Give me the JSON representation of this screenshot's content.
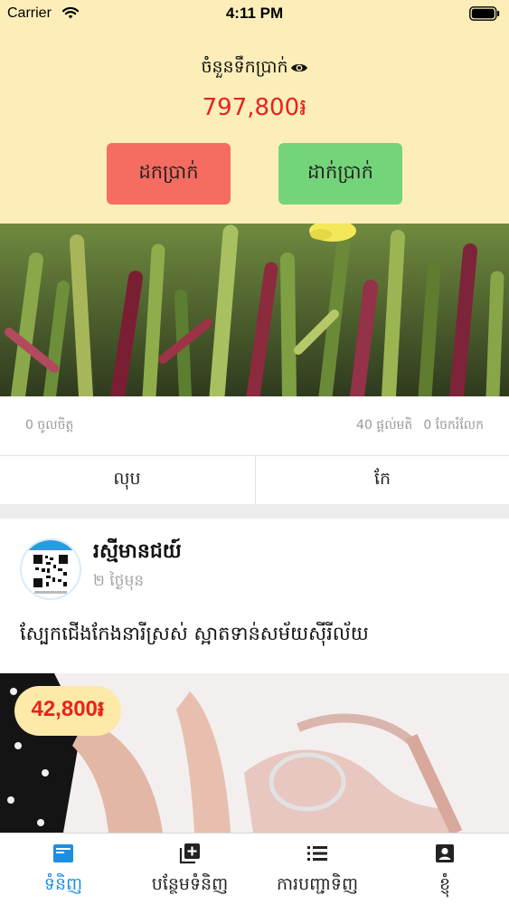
{
  "status_bar": {
    "carrier": "Carrier",
    "time": "4:11 PM",
    "icons": [
      "wifi-icon",
      "battery-icon"
    ]
  },
  "wallet": {
    "title": "ចំនួនទឹកប្រាក់",
    "balance": "797,800៛",
    "withdraw_label": "ដកប្រាក់",
    "deposit_label": "ដាក់ប្រាក់",
    "colors": {
      "background": "#fdeeb9",
      "balance": "#e8221f",
      "withdraw": "#f56c60",
      "deposit": "#74d47a"
    }
  },
  "my_post": {
    "likes": "0 ចូលចិត្ត",
    "messages": "40 ផ្ដល់មតិ",
    "shares": "0 ចែករំលែក",
    "delete_label": "លុប",
    "edit_label": "កែ"
  },
  "feed_post": {
    "author": "រស្មីមានជយ៍",
    "time_ago": "២ ថ្ងៃមុន",
    "text": "ស្បែកជើងកែងនារីស្រស់ ស្អាតទាន់សម័យស៊ីរីល័យ",
    "price": "42,800៛"
  },
  "tab_bar": {
    "active_color": "#1d8fe0",
    "tabs": [
      {
        "label": "ទំនិញ",
        "icon": "newspaper-icon",
        "active": true
      },
      {
        "label": "បន្ថែមទំនិញ",
        "icon": "add-box-icon",
        "active": false
      },
      {
        "label": "ការបញ្ជាទិញ",
        "icon": "list-icon",
        "active": false
      },
      {
        "label": "ខ្ញុំ",
        "icon": "profile-icon",
        "active": false
      }
    ]
  }
}
